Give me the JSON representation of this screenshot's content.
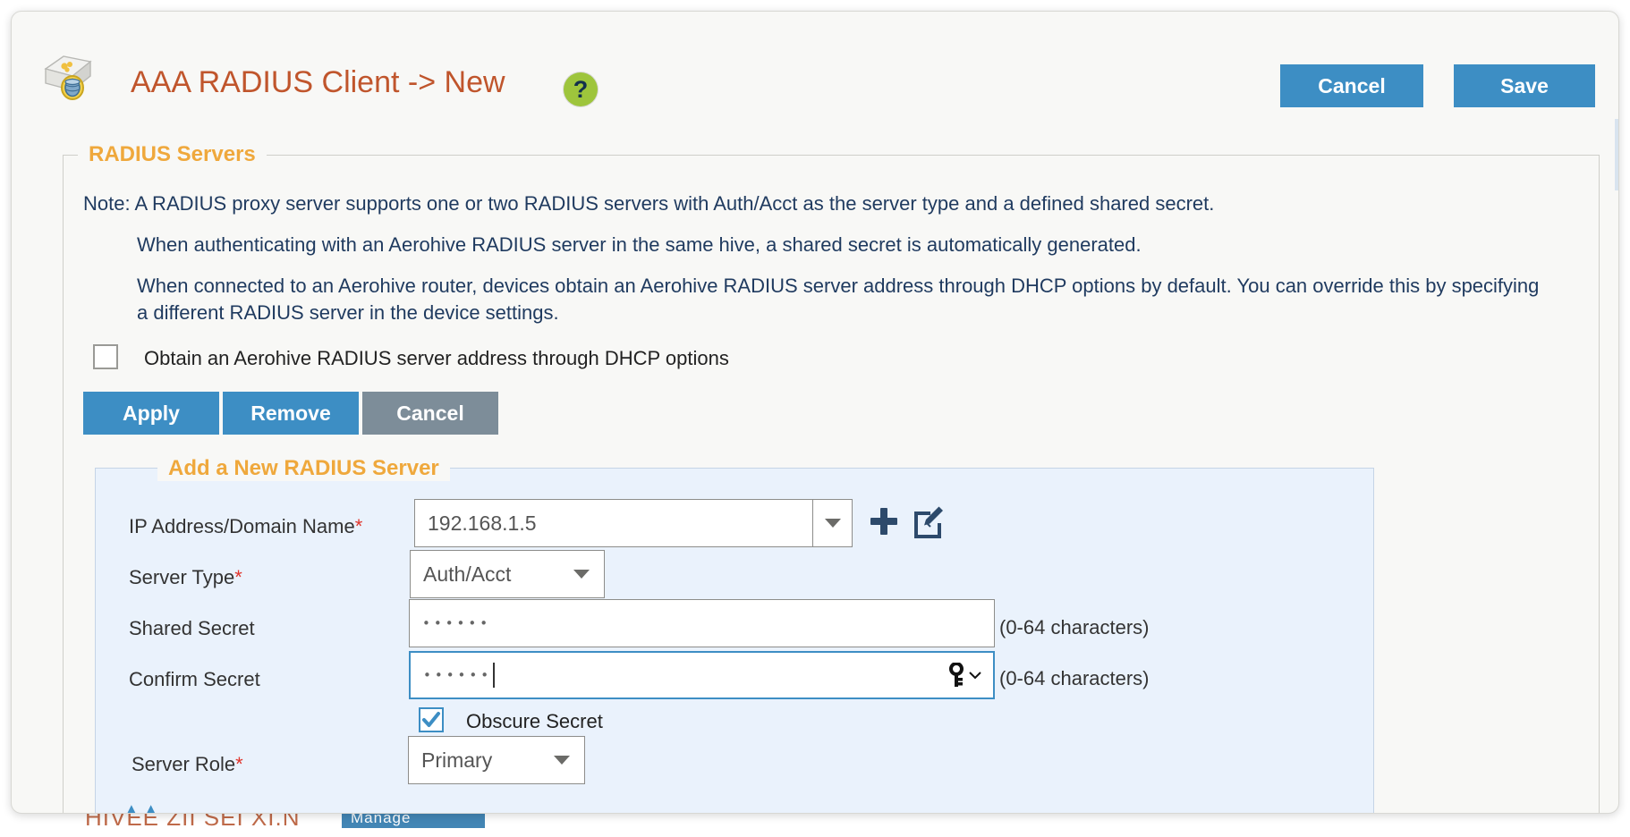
{
  "header": {
    "title": "AAA RADIUS Client -> New",
    "icon": "radius-client-icon",
    "help_icon_glyph": "?",
    "cancel_label": "Cancel",
    "save_label": "Save"
  },
  "section": {
    "legend": "RADIUS Servers",
    "notes": [
      "Note: A RADIUS proxy server supports one or two RADIUS servers with Auth/Acct as the server type and a defined shared secret.",
      "When authenticating with an Aerohive RADIUS server in the same hive, a shared secret is automatically generated.",
      "When connected to an Aerohive router, devices obtain an Aerohive RADIUS server address through DHCP options by default. You can override this by specifying a different RADIUS server in the device settings."
    ],
    "dhcp_checkbox": {
      "label": "Obtain an Aerohive RADIUS server address through DHCP options",
      "checked": false
    },
    "actions": {
      "apply_label": "Apply",
      "remove_label": "Remove",
      "cancel_label": "Cancel"
    }
  },
  "add_server": {
    "legend": "Add a New RADIUS Server",
    "ip_address": {
      "label": "IP Address/Domain Name",
      "required": true,
      "value": "192.168.1.5",
      "add_icon": "plus-icon",
      "edit_icon": "edit-icon"
    },
    "server_type": {
      "label": "Server Type",
      "required": true,
      "value": "Auth/Acct"
    },
    "shared_secret": {
      "label": "Shared Secret",
      "required": false,
      "value": "••••••",
      "hint": "(0-64 characters)"
    },
    "confirm_secret": {
      "label": "Confirm Secret",
      "required": false,
      "value": "••••••",
      "hint": "(0-64 characters)",
      "focused": true,
      "key_icon": "key-icon"
    },
    "obscure_secret": {
      "label": "Obscure Secret",
      "checked": true
    },
    "server_role": {
      "label": "Server Role",
      "required": true,
      "value": "Primary"
    }
  },
  "background": {
    "text": "HIVEE ZII SEI  XI.N",
    "chip_label": "Manage"
  },
  "colors": {
    "accent_blue": "#3d8ec4",
    "legend_orange": "#efa83c",
    "title_orange": "#c0552c",
    "required_red": "#e0342b",
    "panel_blue": "#eaf2fc",
    "gray_button": "#7d8d99",
    "help_green": "#9ec53c"
  }
}
